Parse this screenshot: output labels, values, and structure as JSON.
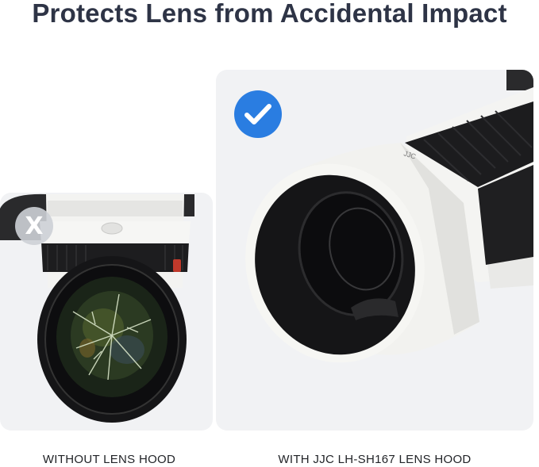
{
  "headline": "Protects Lens from Accidental Impact",
  "panels": {
    "left": {
      "caption": "WITHOUT LENS HOOD",
      "badge_icon": "x-icon",
      "badge_glyph": "X",
      "badge_color": "#cdd0d6"
    },
    "right": {
      "caption": "WITH JJC LH-SH167 LENS HOOD",
      "badge_icon": "checkmark-icon",
      "badge_color": "#2a7de1"
    }
  },
  "colors": {
    "headline": "#2e3446",
    "panel_background": "#f1f2f4",
    "lens_body": "#f4f4f2",
    "rubber_ring": "#1c1c1e",
    "hood": "#f2f2ef"
  }
}
